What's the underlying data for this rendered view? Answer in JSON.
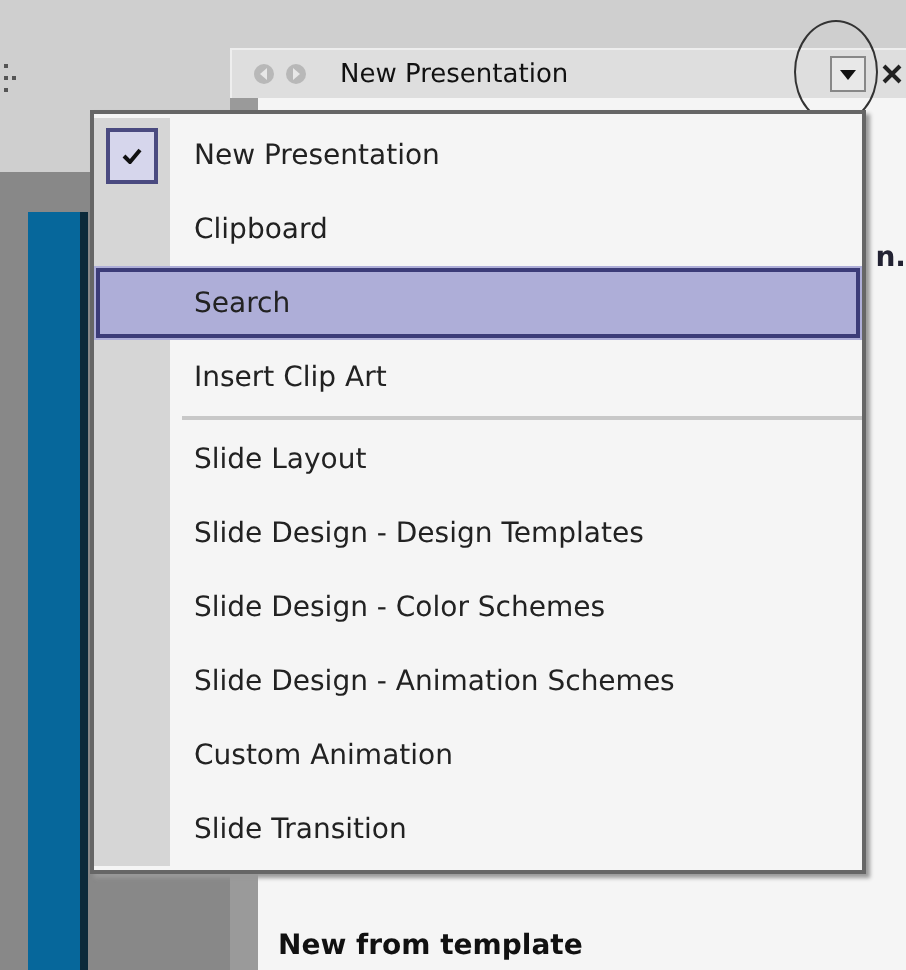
{
  "task_pane": {
    "title": "New Presentation",
    "cut_text": "n.",
    "section_heading": "New from template"
  },
  "menu": {
    "items": [
      {
        "label": "New Presentation",
        "checked": true,
        "selected": false,
        "separator_before": false
      },
      {
        "label": "Clipboard",
        "checked": false,
        "selected": false,
        "separator_before": false
      },
      {
        "label": "Search",
        "checked": false,
        "selected": true,
        "separator_before": false
      },
      {
        "label": "Insert Clip Art",
        "checked": false,
        "selected": false,
        "separator_before": false
      },
      {
        "label": "Slide Layout",
        "checked": false,
        "selected": false,
        "separator_before": true
      },
      {
        "label": "Slide Design - Design Templates",
        "checked": false,
        "selected": false,
        "separator_before": false
      },
      {
        "label": "Slide Design - Color Schemes",
        "checked": false,
        "selected": false,
        "separator_before": false
      },
      {
        "label": "Slide Design - Animation Schemes",
        "checked": false,
        "selected": false,
        "separator_before": false
      },
      {
        "label": "Custom Animation",
        "checked": false,
        "selected": false,
        "separator_before": false
      },
      {
        "label": "Slide Transition",
        "checked": false,
        "selected": false,
        "separator_before": false
      }
    ]
  }
}
